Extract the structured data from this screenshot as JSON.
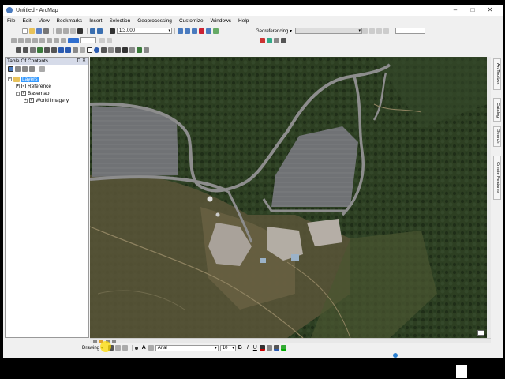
{
  "window": {
    "title": "Untitled - ArcMap",
    "minimize": "–",
    "maximize": "□",
    "close": "✕"
  },
  "menu": [
    "File",
    "Edit",
    "View",
    "Bookmarks",
    "Insert",
    "Selection",
    "Geoprocessing",
    "Customize",
    "Windows",
    "Help"
  ],
  "toolbar": {
    "scale": "1:3,000",
    "georef_label": "Georeferencing ▾",
    "font": "Arial",
    "font_size": "10",
    "drawing_label": "Drawing ▾",
    "bold": "B",
    "italic": "I",
    "underline": "U",
    "text_tool": "A"
  },
  "toc": {
    "title": "Table Of Contents",
    "pin": "⊓",
    "close": "✕",
    "layers": [
      {
        "label": "Layers",
        "level": 0,
        "expanded": true,
        "selected": true
      },
      {
        "label": "Reference",
        "level": 1,
        "expanded": false,
        "checked": true
      },
      {
        "label": "Basemap",
        "level": 1,
        "expanded": true,
        "checked": true
      },
      {
        "label": "World Imagery",
        "level": 2,
        "expanded": false,
        "checked": true
      }
    ]
  },
  "right_tabs": [
    "ArcToolbox",
    "Catalog",
    "Search",
    "Create Features"
  ],
  "colors": {
    "accent": "#3399ff",
    "map_forest": "#2c3d22",
    "road": "#8d8d8d",
    "parking": "#6f6f72",
    "cursor_highlight": "#ffdc00"
  }
}
